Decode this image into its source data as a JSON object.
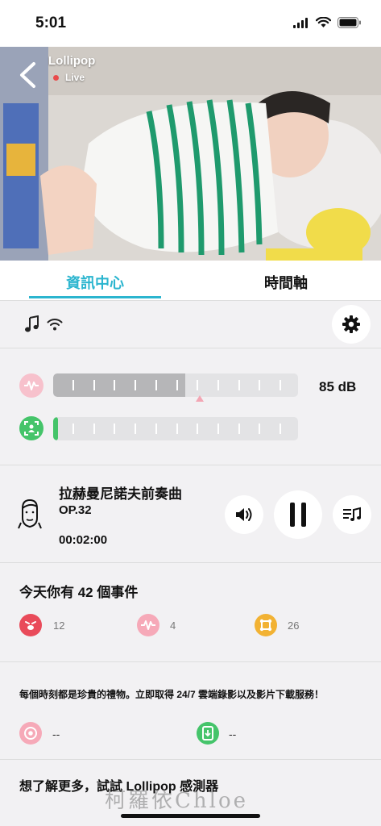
{
  "status_bar": {
    "time": "5:01"
  },
  "camera": {
    "name": "Lollipop",
    "status": "Live"
  },
  "tabs": [
    {
      "label": "資訊中心",
      "active": true
    },
    {
      "label": "時間軸",
      "active": false
    }
  ],
  "icon_row": {
    "left_icons": [
      "music-note-icon",
      "wifi-icon"
    ],
    "settings_icon": "gear-icon"
  },
  "meters": {
    "sound": {
      "icon": "sound-wave-icon",
      "level": 0.54,
      "value": "85 dB",
      "color": "#f4a7b6"
    },
    "motion": {
      "icon": "motion-detect-icon",
      "level": 0.02,
      "color": "#45c46a"
    }
  },
  "music": {
    "title": "拉赫曼尼諾夫前奏曲",
    "subtitle": "OP.32",
    "time": "00:02:00",
    "icon": "composer-portrait-icon",
    "controls": [
      "volume-icon",
      "pause-icon",
      "playlist-icon"
    ]
  },
  "events": {
    "title": "今天你有 42 個事件",
    "items": [
      {
        "icon": "crying-face-icon",
        "count": "12",
        "color": "#e94b5a"
      },
      {
        "icon": "sound-wave-icon",
        "count": "4",
        "color": "#f6a9b8"
      },
      {
        "icon": "motion-detect-icon",
        "count": "26",
        "color": "#f2b233"
      }
    ]
  },
  "promo": {
    "text": "每個時刻都是珍貴的禮物。立即取得 24/7 雲端錄影以及影片下載服務！",
    "items": [
      {
        "icon": "cloud-record-icon",
        "value": "--",
        "color": "#f6a9b8"
      },
      {
        "icon": "video-download-icon",
        "value": "--",
        "color": "#45c46a"
      }
    ]
  },
  "sensor": {
    "text": "想了解更多，試試 Lollipop 感測器"
  },
  "watermark": {
    "text": "柯羅依Chloe"
  },
  "colors": {
    "accent": "#2bb5cf",
    "background": "#f2f1f3"
  }
}
